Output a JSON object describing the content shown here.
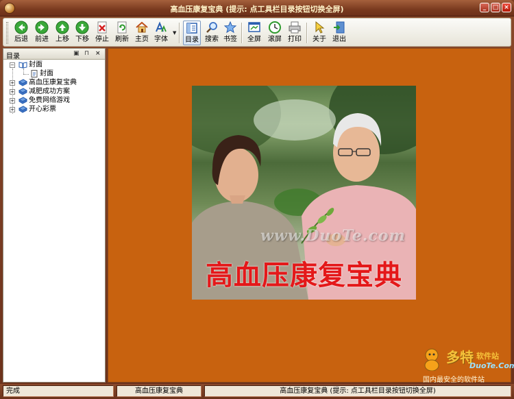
{
  "window": {
    "title": "高血压康复宝典 (提示: 点工具栏目录按钮切换全屏)",
    "min_glyph": "_",
    "max_glyph": "□",
    "close_glyph": "×"
  },
  "toolbar": {
    "back": {
      "label": "后退",
      "icon": "back-arrow-icon",
      "color": "#2e9a2e"
    },
    "forward": {
      "label": "前进",
      "icon": "forward-arrow-icon",
      "color": "#2e9a2e"
    },
    "move_up": {
      "label": "上移",
      "icon": "up-arrow-icon",
      "color": "#2e9a2e"
    },
    "move_down": {
      "label": "下移",
      "icon": "down-arrow-icon",
      "color": "#2e9a2e"
    },
    "stop": {
      "label": "停止",
      "icon": "stop-icon",
      "color": "#d42020"
    },
    "refresh": {
      "label": "刷新",
      "icon": "refresh-icon",
      "color": "#2e9a2e"
    },
    "home": {
      "label": "主页",
      "icon": "home-icon",
      "color": "#e08a1a"
    },
    "font": {
      "label": "字体",
      "icon": "font-icon",
      "color": "#2a5fb0"
    },
    "contents": {
      "label": "目录",
      "icon": "contents-icon",
      "color": "#2a5fb0"
    },
    "search": {
      "label": "搜索",
      "icon": "search-icon",
      "color": "#3a6fc2"
    },
    "bookmark": {
      "label": "书签",
      "icon": "bookmark-star-icon",
      "color": "#3a6fc2"
    },
    "fullscreen": {
      "label": "全屏",
      "icon": "fullscreen-icon",
      "color": "#2a5fb0"
    },
    "autoscroll": {
      "label": "滚屏",
      "icon": "autoscroll-clock-icon",
      "color": "#2e9a2e"
    },
    "print": {
      "label": "打印",
      "icon": "printer-icon",
      "color": "#666666"
    },
    "about": {
      "label": "关于",
      "icon": "about-cursor-icon",
      "color": "#e0b020"
    },
    "exit": {
      "label": "退出",
      "icon": "exit-door-icon",
      "color": "#2a5fb0"
    }
  },
  "sidebar": {
    "title": "目录",
    "pin_glyph": "⊓",
    "close_glyph": "×",
    "items": [
      {
        "label": "封面",
        "expander": "−"
      },
      {
        "label": "封面"
      },
      {
        "label": "高血压康复宝典",
        "expander": "+"
      },
      {
        "label": "减肥成功方案",
        "expander": "+"
      },
      {
        "label": "免费网络游戏",
        "expander": "+"
      },
      {
        "label": "开心彩票",
        "expander": "+"
      }
    ]
  },
  "content": {
    "cover_title": "高血压康复宝典",
    "watermark": "www.DuoTe.com",
    "corner_brand": "多特",
    "corner_brand_suffix": "软件站",
    "corner_url": "DuoTe.Com",
    "corner_slogan": "国内最安全的软件站",
    "background_color": "#c8620f",
    "title_color": "#e4181a"
  },
  "status": {
    "state": "完成",
    "book": "高血压康复宝典",
    "hint": "高血压康复宝典 (提示: 点工具栏目录按钮切换全屏)"
  }
}
